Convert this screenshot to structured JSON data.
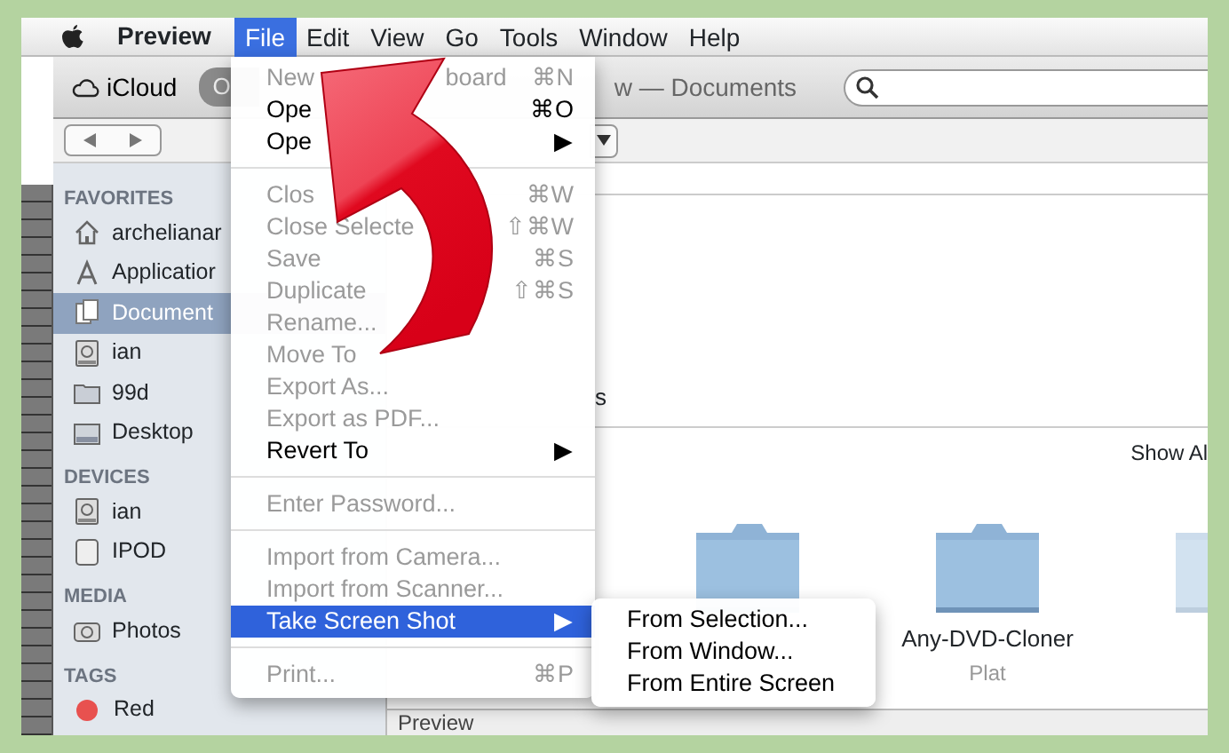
{
  "menu_bar": {
    "app_name": "Preview",
    "menus": [
      {
        "label": "File",
        "selected": true
      },
      {
        "label": "Edit",
        "selected": false
      },
      {
        "label": "View",
        "selected": false
      },
      {
        "label": "Go",
        "selected": false
      },
      {
        "label": "Tools",
        "selected": false
      },
      {
        "label": "Window",
        "selected": false
      },
      {
        "label": "Help",
        "selected": false
      }
    ]
  },
  "toolbar": {
    "icloud_button": "iCloud",
    "toggle": "O",
    "title": "w — Documents"
  },
  "sidebar": [
    {
      "title": "FAVORITES",
      "items": [
        {
          "kind": "home",
          "label": "archelianar",
          "selected": false
        },
        {
          "kind": "apps",
          "label": "Applicatior",
          "selected": false
        },
        {
          "kind": "documents",
          "label": "Document",
          "selected": true
        },
        {
          "kind": "drive",
          "label": "ian",
          "selected": false
        },
        {
          "kind": "folder",
          "label": "99d",
          "selected": false
        },
        {
          "kind": "desktop",
          "label": "Desktop",
          "selected": false
        }
      ]
    },
    {
      "title": "DEVICES",
      "items": [
        {
          "kind": "drive",
          "label": "ian",
          "selected": false
        },
        {
          "kind": "ipod",
          "label": "IPOD",
          "selected": false
        }
      ]
    },
    {
      "title": "MEDIA",
      "items": [
        {
          "kind": "camera",
          "label": "Photos",
          "selected": false
        }
      ]
    },
    {
      "title": "TAGS",
      "items": [
        {
          "kind": "tag",
          "label": "Red",
          "color": "#e8514f",
          "selected": false
        }
      ]
    }
  ],
  "content": {
    "fragment": "s",
    "show_all": "Show Al",
    "folders": [
      {
        "kind": "plain"
      },
      {
        "kind": "labeled",
        "label": "Any-DVD-Cloner",
        "sublabel": "Plat"
      },
      {
        "kind": "partial"
      }
    ],
    "footer": "Preview"
  },
  "file_menu": [
    {
      "kind": "item",
      "label": "New",
      "label_tail": "board",
      "shortcut": "⌘N",
      "disabled": true,
      "selected": false
    },
    {
      "kind": "item",
      "label": "Ope",
      "shortcut": "⌘O",
      "disabled": false,
      "selected": false
    },
    {
      "kind": "item",
      "label": "Ope",
      "shortcut": "▶",
      "disabled": false,
      "selected": false
    },
    {
      "kind": "separator"
    },
    {
      "kind": "item",
      "label": "Clos",
      "shortcut": "⌘W",
      "disabled": true,
      "selected": false
    },
    {
      "kind": "item",
      "label": "Close Selecte",
      "shortcut": "⇧⌘W",
      "disabled": true,
      "selected": false
    },
    {
      "kind": "item",
      "label": "Save",
      "shortcut": "⌘S",
      "disabled": true,
      "selected": false
    },
    {
      "kind": "item",
      "label": "Duplicate",
      "shortcut": "⇧⌘S",
      "disabled": true,
      "selected": false
    },
    {
      "kind": "item",
      "label": "Rename...",
      "disabled": true,
      "selected": false
    },
    {
      "kind": "item",
      "label": "Move To",
      "disabled": true,
      "selected": false
    },
    {
      "kind": "item",
      "label": "Export As...",
      "disabled": true,
      "selected": false
    },
    {
      "kind": "item",
      "label": "Export as PDF...",
      "disabled": true,
      "selected": false
    },
    {
      "kind": "item",
      "label": "Revert To",
      "shortcut": "▶",
      "disabled": false,
      "selected": false
    },
    {
      "kind": "separator"
    },
    {
      "kind": "item",
      "label": "Enter Password...",
      "disabled": true,
      "selected": false
    },
    {
      "kind": "separator"
    },
    {
      "kind": "item",
      "label": "Import from Camera...",
      "disabled": true,
      "selected": false
    },
    {
      "kind": "item",
      "label": "Import from Scanner...",
      "disabled": true,
      "selected": false
    },
    {
      "kind": "item",
      "label": "Take Screen Shot",
      "shortcut": "▶",
      "disabled": false,
      "selected": true
    },
    {
      "kind": "separator"
    },
    {
      "kind": "item",
      "label": "Print...",
      "shortcut": "⌘P",
      "disabled": true,
      "selected": false
    }
  ],
  "submenu": [
    {
      "label": "From Selection...",
      "selected": false
    },
    {
      "label": "From Window...",
      "selected": false
    },
    {
      "label": "From Entire Screen",
      "selected": false
    }
  ]
}
